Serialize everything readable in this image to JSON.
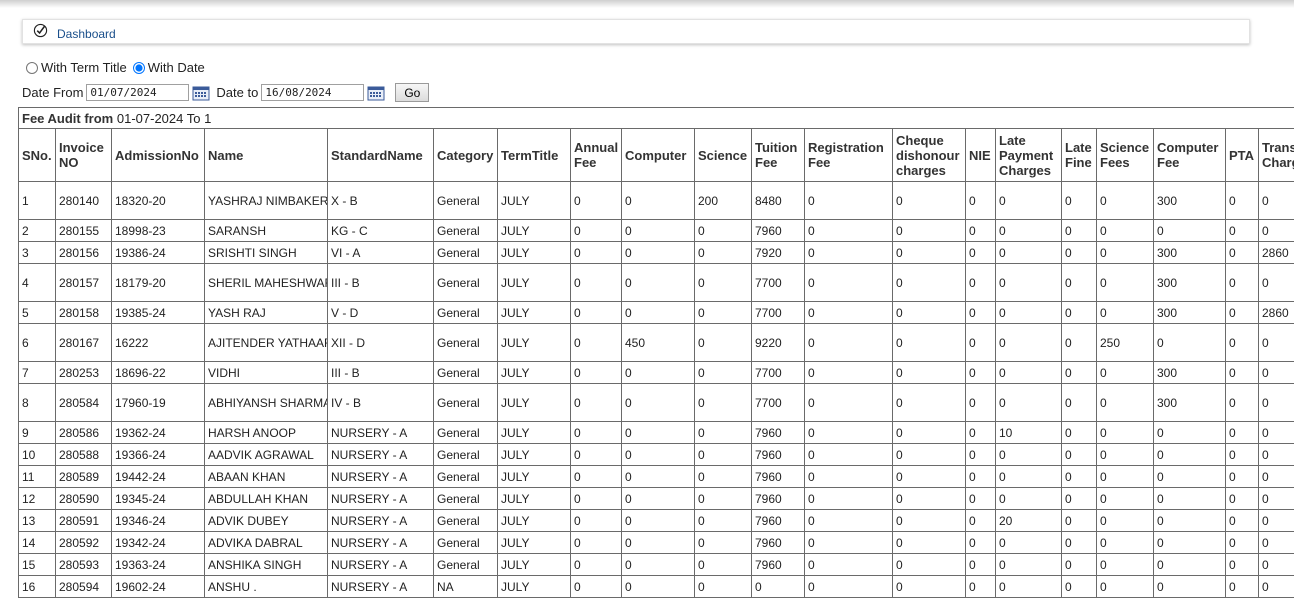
{
  "breadcrumb": {
    "label": "Dashboard"
  },
  "filters": {
    "radio_term_label": "With Term Title",
    "radio_date_label": "With Date",
    "date_from_label": "Date From",
    "date_from_value": "01/07/2024",
    "date_to_label": "Date to",
    "date_to_value": "16/08/2024",
    "go_label": "Go"
  },
  "table": {
    "audit_title_bold": "Fee Audit from",
    "audit_title_range": "01-07-2024 To 1",
    "columns": [
      "SNo.",
      "Invoice NO",
      "AdmissionNo",
      "Name",
      "StandardName",
      "Category",
      "TermTitle",
      "Annual Fee",
      "Computer",
      "Science",
      "Tuition Fee",
      "Registration Fee",
      "Cheque dishonour charges",
      "NIE",
      "Late Payment Charges",
      "Late Fine",
      "Science Fees",
      "Computer Fee",
      "PTA",
      "Trans Charg"
    ],
    "rows": [
      [
        "1",
        "280140",
        "18320-20",
        "YASHRAJ NIMBAKER",
        "X - B",
        "General",
        "JULY",
        "0",
        "0",
        "200",
        "8480",
        "0",
        "0",
        "0",
        "0",
        "0",
        "0",
        "300",
        "0",
        "0"
      ],
      [
        "2",
        "280155",
        "18998-23",
        "SARANSH",
        "KG - C",
        "General",
        "JULY",
        "0",
        "0",
        "0",
        "7960",
        "0",
        "0",
        "0",
        "0",
        "0",
        "0",
        "0",
        "0",
        "0"
      ],
      [
        "3",
        "280156",
        "19386-24",
        "SRISHTI SINGH",
        "VI - A",
        "General",
        "JULY",
        "0",
        "0",
        "0",
        "7920",
        "0",
        "0",
        "0",
        "0",
        "0",
        "0",
        "300",
        "0",
        "2860"
      ],
      [
        "4",
        "280157",
        "18179-20",
        "SHERIL MAHESHWARI",
        "III - B",
        "General",
        "JULY",
        "0",
        "0",
        "0",
        "7700",
        "0",
        "0",
        "0",
        "0",
        "0",
        "0",
        "300",
        "0",
        "0"
      ],
      [
        "5",
        "280158",
        "19385-24",
        "YASH RAJ",
        "V - D",
        "General",
        "JULY",
        "0",
        "0",
        "0",
        "7700",
        "0",
        "0",
        "0",
        "0",
        "0",
        "0",
        "300",
        "0",
        "2860"
      ],
      [
        "6",
        "280167",
        "16222",
        "AJITENDER YATHAARTH",
        "XII - D",
        "General",
        "JULY",
        "0",
        "450",
        "0",
        "9220",
        "0",
        "0",
        "0",
        "0",
        "0",
        "250",
        "0",
        "0",
        "0"
      ],
      [
        "7",
        "280253",
        "18696-22",
        "VIDHI",
        "III - B",
        "General",
        "JULY",
        "0",
        "0",
        "0",
        "7700",
        "0",
        "0",
        "0",
        "0",
        "0",
        "0",
        "300",
        "0",
        "0"
      ],
      [
        "8",
        "280584",
        "17960-19",
        "ABHIYANSH SHARMA",
        "IV - B",
        "General",
        "JULY",
        "0",
        "0",
        "0",
        "7700",
        "0",
        "0",
        "0",
        "0",
        "0",
        "0",
        "300",
        "0",
        "0"
      ],
      [
        "9",
        "280586",
        "19362-24",
        "HARSH ANOOP",
        "NURSERY - A",
        "General",
        "JULY",
        "0",
        "0",
        "0",
        "7960",
        "0",
        "0",
        "0",
        "10",
        "0",
        "0",
        "0",
        "0",
        "0"
      ],
      [
        "10",
        "280588",
        "19366-24",
        "AADVIK AGRAWAL",
        "NURSERY - A",
        "General",
        "JULY",
        "0",
        "0",
        "0",
        "7960",
        "0",
        "0",
        "0",
        "0",
        "0",
        "0",
        "0",
        "0",
        "0"
      ],
      [
        "11",
        "280589",
        "19442-24",
        "ABAAN KHAN",
        "NURSERY - A",
        "General",
        "JULY",
        "0",
        "0",
        "0",
        "7960",
        "0",
        "0",
        "0",
        "0",
        "0",
        "0",
        "0",
        "0",
        "0"
      ],
      [
        "12",
        "280590",
        "19345-24",
        "ABDULLAH KHAN",
        "NURSERY - A",
        "General",
        "JULY",
        "0",
        "0",
        "0",
        "7960",
        "0",
        "0",
        "0",
        "0",
        "0",
        "0",
        "0",
        "0",
        "0"
      ],
      [
        "13",
        "280591",
        "19346-24",
        "ADVIK DUBEY",
        "NURSERY - A",
        "General",
        "JULY",
        "0",
        "0",
        "0",
        "7960",
        "0",
        "0",
        "0",
        "20",
        "0",
        "0",
        "0",
        "0",
        "0"
      ],
      [
        "14",
        "280592",
        "19342-24",
        "ADVIKA DABRAL",
        "NURSERY - A",
        "General",
        "JULY",
        "0",
        "0",
        "0",
        "7960",
        "0",
        "0",
        "0",
        "0",
        "0",
        "0",
        "0",
        "0",
        "0"
      ],
      [
        "15",
        "280593",
        "19363-24",
        "ANSHIKA SINGH",
        "NURSERY - A",
        "General",
        "JULY",
        "0",
        "0",
        "0",
        "7960",
        "0",
        "0",
        "0",
        "0",
        "0",
        "0",
        "0",
        "0",
        "0"
      ],
      [
        "16",
        "280594",
        "19602-24",
        "ANSHU .",
        "NURSERY - A",
        "NA",
        "JULY",
        "0",
        "0",
        "0",
        "0",
        "0",
        "0",
        "0",
        "0",
        "0",
        "0",
        "0",
        "0",
        "0"
      ]
    ],
    "tall_rows": [
      0,
      3,
      5,
      7
    ]
  }
}
